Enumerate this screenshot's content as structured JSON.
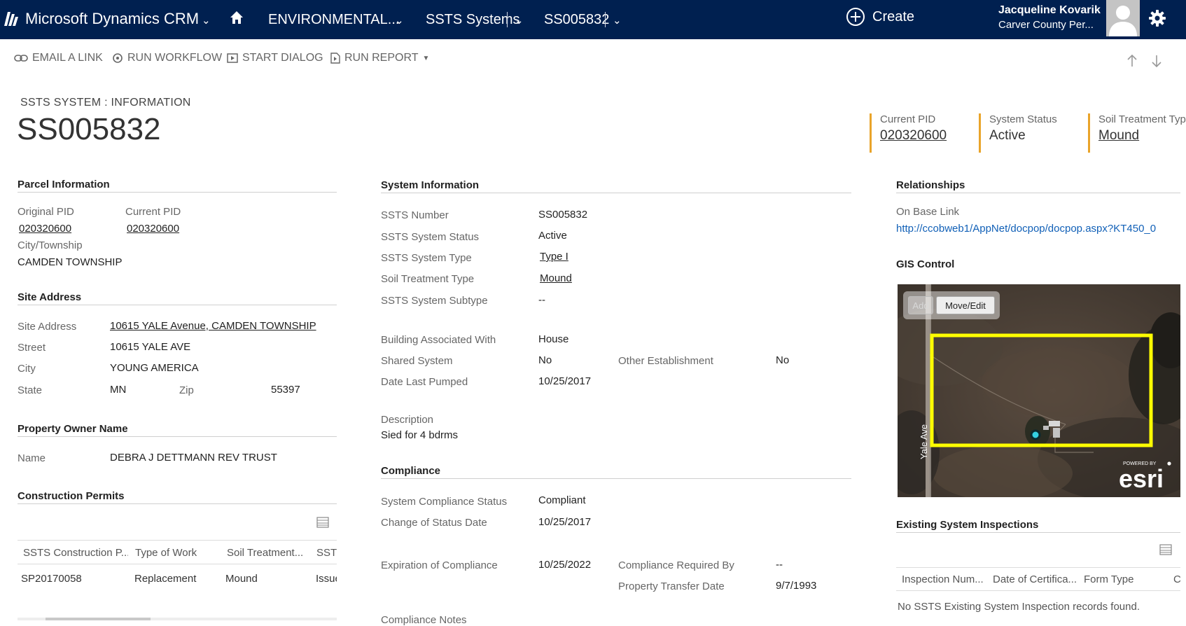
{
  "nav": {
    "app_title": "Microsoft Dynamics CRM",
    "area": "ENVIRONMENTAL...",
    "entity": "SSTS Systems",
    "record": "SS005832",
    "create_label": "Create",
    "user_name": "Jacqueline Kovarik",
    "user_org": "Carver County Per...",
    "icons": [
      "dynamics-logo-icon",
      "home-icon",
      "chevron-down-icon",
      "plus-circle-icon",
      "avatar",
      "gear-icon"
    ]
  },
  "commands": {
    "email_link": "EMAIL A LINK",
    "run_workflow": "RUN WORKFLOW",
    "start_dialog": "START DIALOG",
    "run_report": "RUN REPORT",
    "icons": [
      "link-icon",
      "workflow-icon",
      "dialog-icon",
      "report-icon",
      "arrow-up-icon",
      "arrow-down-icon"
    ]
  },
  "header": {
    "entity_label": "SSTS SYSTEM : INFORMATION",
    "title": "SS005832",
    "fields": [
      {
        "label": "Current PID",
        "value": "020320600"
      },
      {
        "label": "System Status",
        "value": "Active"
      },
      {
        "label": "Soil Treatment Typ",
        "value": "Mound"
      }
    ]
  },
  "parcel": {
    "title": "Parcel Information",
    "original_pid_label": "Original PID",
    "original_pid": "020320600",
    "current_pid_label": "Current PID",
    "current_pid": "020320600",
    "city_township_label": "City/Township",
    "city_township": "CAMDEN TOWNSHIP"
  },
  "site_address": {
    "title": "Site Address",
    "site_address_label": "Site Address",
    "site_address": "10615 YALE Avenue, CAMDEN TOWNSHIP",
    "street_label": "Street",
    "street": "10615 YALE AVE",
    "city_label": "City",
    "city": "YOUNG AMERICA",
    "state_label": "State",
    "state": "MN",
    "zip_label": "Zip",
    "zip": "55397"
  },
  "owner": {
    "title": "Property Owner Name",
    "name_label": "Name",
    "name": "DEBRA J DETTMANN REV TRUST"
  },
  "permits": {
    "title": "Construction Permits",
    "columns": [
      "SSTS Construction P...",
      "Type of Work",
      "Soil Treatment...",
      "SST!"
    ],
    "rows": [
      [
        "SP20170058",
        "Replacement",
        "Mound",
        "Issue"
      ]
    ]
  },
  "system_info": {
    "title": "System Information",
    "fields": [
      {
        "label": "SSTS Number",
        "value": "SS005832"
      },
      {
        "label": "SSTS System Status",
        "value": "Active"
      },
      {
        "label": "SSTS System Type",
        "value": "Type I"
      },
      {
        "label": "Soil Treatment Type",
        "value": "Mound"
      },
      {
        "label": "SSTS System Subtype",
        "value": "--"
      }
    ],
    "building_label": "Building Associated With",
    "building": "House",
    "shared_label": "Shared System",
    "shared": "No",
    "other_label": "Other Establishment",
    "other": "No",
    "pumped_label": "Date Last Pumped",
    "pumped": "10/25/2017",
    "description_label": "Description",
    "description": "Sied for 4 bdrms"
  },
  "compliance": {
    "title": "Compliance",
    "status_label": "System Compliance Status",
    "status": "Compliant",
    "change_label": "Change of Status Date",
    "change": "10/25/2017",
    "expiration_label": "Expiration of Compliance",
    "expiration": "10/25/2022",
    "required_label": "Compliance Required By",
    "required": "--",
    "transfer_label": "Property Transfer Date",
    "transfer": "9/7/1993",
    "notes_label": "Compliance Notes"
  },
  "relationships": {
    "title": "Relationships",
    "onbase_label": "On Base Link",
    "onbase_url": "http://ccobweb1/AppNet/docpop/docpop.aspx?KT450_0"
  },
  "gis": {
    "title": "GIS Control",
    "add_label": "Add",
    "move_label": "Move/Edit",
    "road_label": "Yale Ave",
    "powered_label": "POWERED BY",
    "brand": "esri"
  },
  "inspections": {
    "title": "Existing System Inspections",
    "columns": [
      "Inspection Num...",
      "Date of Certifica...",
      "Form Type",
      "C"
    ],
    "empty_text": "No SSTS Existing System Inspection records found."
  }
}
